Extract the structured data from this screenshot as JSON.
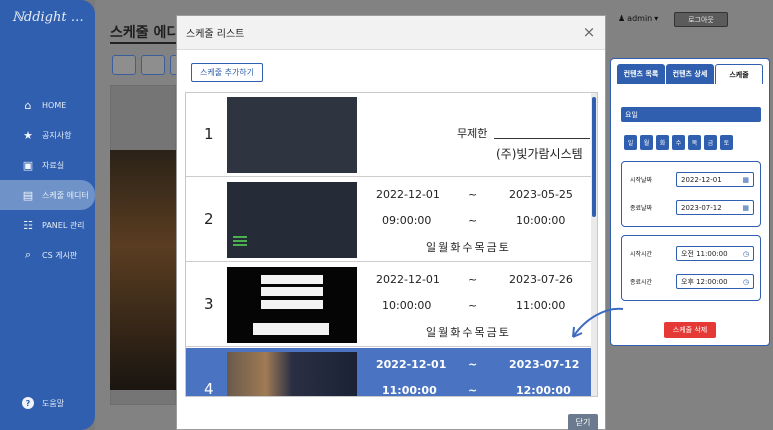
{
  "app": {
    "logo": "ℕddight …"
  },
  "sidebar": {
    "items": [
      {
        "label": "HOME",
        "icon": "home-icon",
        "glyph": "⌂"
      },
      {
        "label": "공지사항",
        "icon": "pin-icon",
        "glyph": "★"
      },
      {
        "label": "자료실",
        "icon": "archive-icon",
        "glyph": "▣"
      },
      {
        "label": "스케줄 에디터",
        "icon": "schedule-icon",
        "glyph": "▤",
        "active": true
      },
      {
        "label": "PANEL 관리",
        "icon": "panel-icon",
        "glyph": "☷"
      },
      {
        "label": "CS 게시판",
        "icon": "cs-icon",
        "glyph": "⌕"
      }
    ],
    "help_label": "도움말",
    "help_glyph": "?"
  },
  "header": {
    "page_title": "스케줄 에디",
    "user": "admin",
    "user_glyph": "▾",
    "logout_label": "로그아웃"
  },
  "right_panel": {
    "tabs": [
      "컨텐츠 목록",
      "컨텐츠 상세",
      "스케줄"
    ],
    "select_label": "요일",
    "days": [
      "일",
      "월",
      "화",
      "수",
      "목",
      "금",
      "토"
    ],
    "start_date_label": "시작날짜",
    "start_date": "2022-12-01",
    "end_date_label": "종료날짜",
    "end_date": "2023-07-12",
    "start_time_label": "시작시간",
    "start_time": "오전 11:00:00",
    "end_time_label": "종료시간",
    "end_time": "오후 12:00:00",
    "delete_label": "스케줄 삭제"
  },
  "modal": {
    "title": "스케줄 리스트",
    "close_glyph": "×",
    "add_label": "스케줄 추가하기",
    "footer_close_label": "닫기",
    "rows": [
      {
        "num": "1",
        "unlimited": "무제한",
        "company": "(주)빛가람시스템"
      },
      {
        "num": "2",
        "start_date": "2022-12-01",
        "sep": "~",
        "end_date": "2023-05-25",
        "start_time": "09:00:00",
        "end_time": "10:00:00",
        "weekdays": "일월화수목금토"
      },
      {
        "num": "3",
        "start_date": "2022-12-01",
        "sep": "~",
        "end_date": "2023-07-26",
        "start_time": "10:00:00",
        "end_time": "11:00:00",
        "weekdays": "일월화수목금토"
      },
      {
        "num": "4",
        "start_date": "2022-12-01",
        "sep": "~",
        "end_date": "2023-07-12",
        "start_time": "11:00:00",
        "end_time": "12:00:00",
        "selected": true
      }
    ]
  },
  "colors": {
    "primary": "#2f5fae",
    "selected_row": "#4a74c2",
    "danger": "#e53935"
  }
}
